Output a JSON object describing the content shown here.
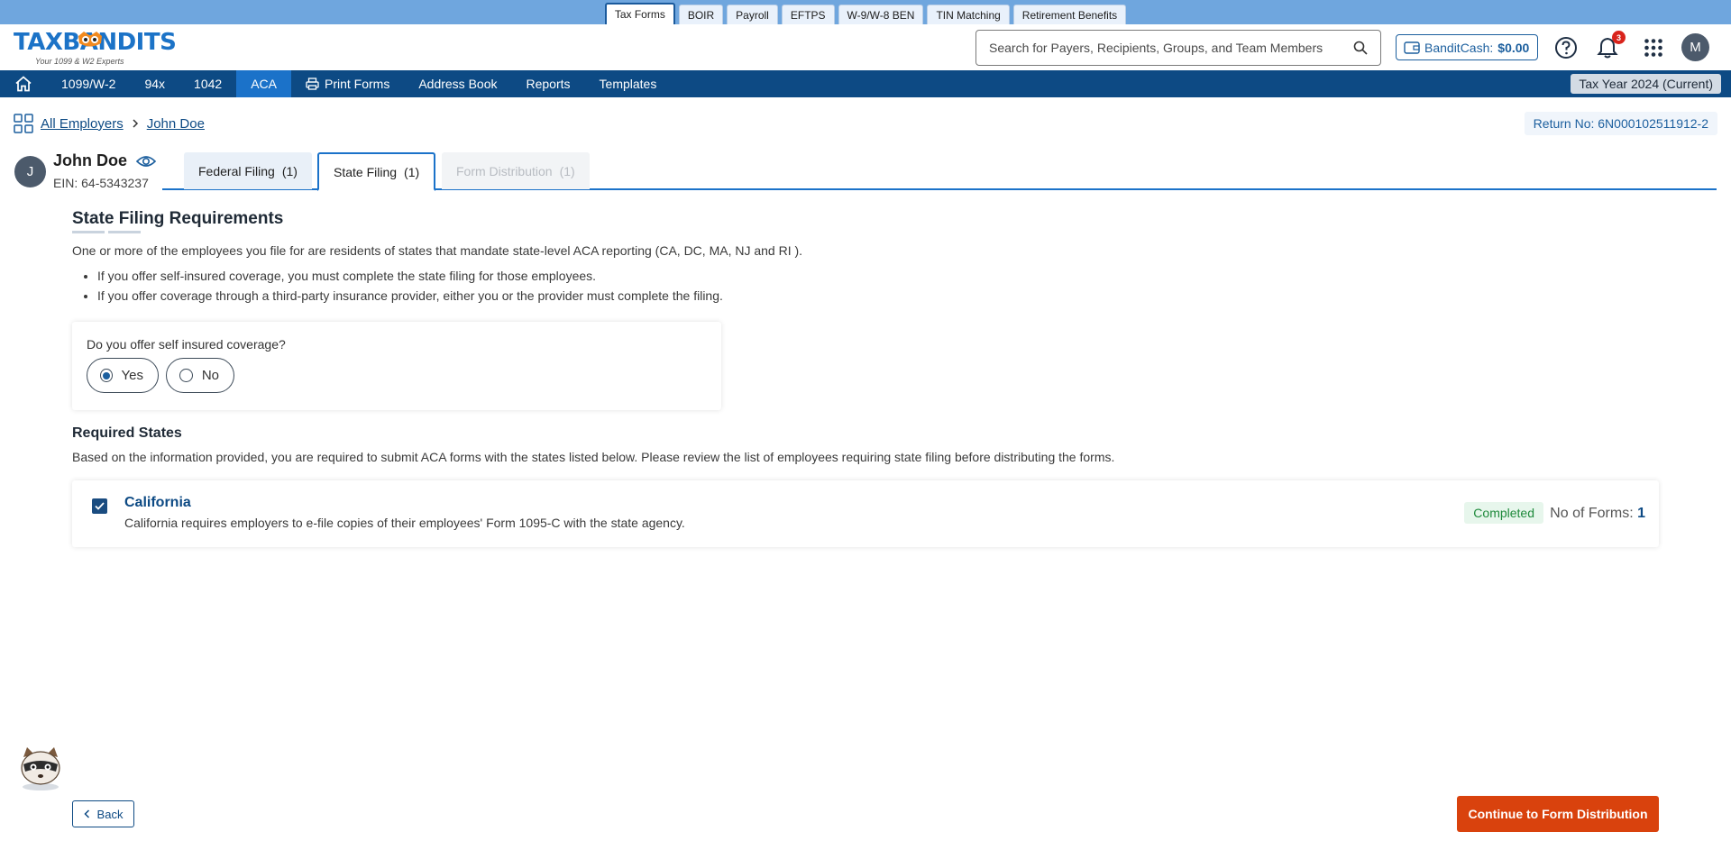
{
  "product_tabs": [
    "Tax Forms",
    "BOIR",
    "Payroll",
    "EFTPS",
    "W-9/W-8 BEN",
    "TIN Matching",
    "Retirement Benefits"
  ],
  "active_product_tab": "Tax Forms",
  "logo": {
    "text": "TAXBANDITS",
    "tagline": "Your 1099 & W2 Experts"
  },
  "search": {
    "placeholder": "Search for Payers, Recipients, Groups, and Team Members"
  },
  "bandit_cash": {
    "label": "BanditCash:",
    "amount": "$0.00"
  },
  "notifications": {
    "count": "3"
  },
  "user": {
    "initial": "M"
  },
  "nav": {
    "items": [
      "1099/W-2",
      "94x",
      "1042",
      "ACA",
      "Print Forms",
      "Address Book",
      "Reports",
      "Templates"
    ],
    "active": "ACA",
    "tax_year": "Tax Year 2024 (Current)"
  },
  "breadcrumb": {
    "root": "All Employers",
    "current": "John Doe"
  },
  "return_no": "Return No: 6N000102511912-2",
  "employer": {
    "initial": "J",
    "name": "John Doe",
    "ein": "EIN: 64-5343237"
  },
  "tabs": {
    "federal": {
      "label": "Federal Filing",
      "count": "(1)"
    },
    "state": {
      "label": "State Filing",
      "count": "(1)"
    },
    "distribution": {
      "label": "Form Distribution",
      "count": "(1)"
    }
  },
  "requirements": {
    "title": "State Filing Requirements",
    "intro": "One or more of the employees you file for are residents of states that mandate state-level ACA reporting (CA, DC, MA, NJ and RI ).",
    "bullets": [
      "If you offer self-insured coverage, you must complete the state filing for those employees.",
      "If you offer coverage through a third-party insurance provider, either you or the provider must complete the filing."
    ],
    "question": "Do you offer self insured coverage?",
    "options": {
      "yes": "Yes",
      "no": "No"
    },
    "selected": "Yes"
  },
  "required_states": {
    "title": "Required States",
    "description": "Based on the information provided, you are required to submit ACA forms with the states listed below. Please review the list of employees requiring state filing before distributing the forms.",
    "states": [
      {
        "name": "California",
        "text": "California requires employers to e-file copies of their employees' Form 1095-C with the state agency.",
        "status": "Completed",
        "forms_label": "No of Forms:",
        "forms_count": "1",
        "checked": true
      }
    ]
  },
  "footer": {
    "back": "Back",
    "continue": "Continue to Form Distribution"
  },
  "colors": {
    "nav": "#0d4a84",
    "accent": "#1b72c9",
    "primary_action": "#d9420d",
    "status_completed": "#1f8a3c"
  }
}
